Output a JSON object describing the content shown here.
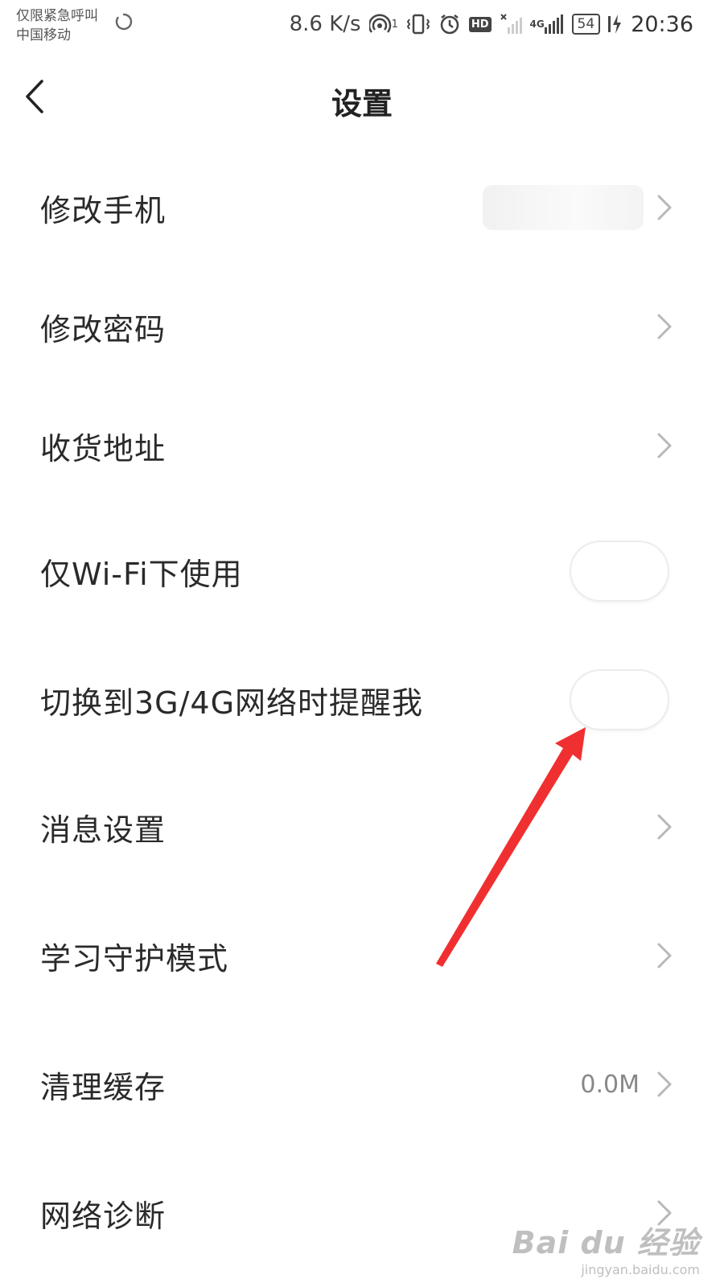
{
  "status_bar": {
    "carrier_line1": "仅限紧急呼叫",
    "carrier_line2": "中国移动",
    "net_speed": "8.6 K/s",
    "hotspot_badge": "1",
    "hd_label": "HD",
    "network_type": "4G",
    "battery": "54",
    "time": "20:36"
  },
  "header": {
    "title": "设置"
  },
  "settings": {
    "items": [
      {
        "label": "修改手机",
        "kind": "link-blurred"
      },
      {
        "label": "修改密码",
        "kind": "link"
      },
      {
        "label": "收货地址",
        "kind": "link"
      },
      {
        "label": "仅Wi-Fi下使用",
        "kind": "toggle",
        "on": false
      },
      {
        "label": "切换到3G/4G网络时提醒我",
        "kind": "toggle",
        "on": false
      },
      {
        "label": "消息设置",
        "kind": "link"
      },
      {
        "label": "学习守护模式",
        "kind": "link"
      },
      {
        "label": "清理缓存",
        "kind": "link-value",
        "value": "0.0M"
      },
      {
        "label": "网络诊断",
        "kind": "link"
      }
    ]
  },
  "watermark": {
    "logo": "Bai du 经验",
    "url": "jingyan.baidu.com"
  },
  "colors": {
    "annotation_arrow": "#f03030",
    "chevron": "#b8b8b8"
  }
}
